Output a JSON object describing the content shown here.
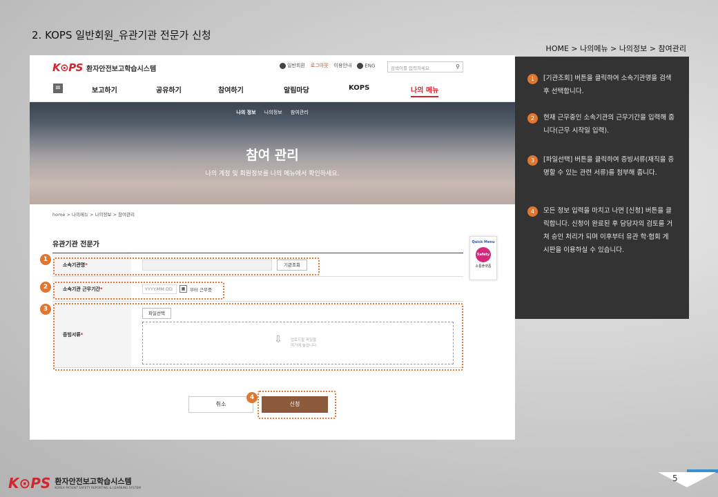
{
  "slide": {
    "heading": "2. KOPS 일반회원_유관기관 전문가 신청",
    "breadcrumb": "HOME > 나의메뉴 > 나의정보 > 참여관리",
    "page_number": "5"
  },
  "site": {
    "logo_mark": "K⊙PS",
    "logo_text": "환자안전보고학습시스템",
    "util_links": [
      "일반회원",
      "로그아웃",
      "이용안내",
      "ENG"
    ],
    "search_placeholder": "검색어를 입력하세요",
    "menu_items": [
      "보고하기",
      "공유하기",
      "참여하기",
      "알림마당",
      "KOPS",
      "나의 메뉴"
    ],
    "active_menu": "나의 메뉴"
  },
  "hero": {
    "tabs": [
      "나의 정보",
      "나의정보",
      "참여관리"
    ],
    "title": "참여 관리",
    "subtitle": "나의 계정 및 회원정보를 나의 메뉴에서 확인하세요."
  },
  "breadcrumb": "home > 나의메뉴 > 나의정보 > 참여관리",
  "form": {
    "section_title": "유관기관 전문가",
    "org_label": "소속기관명",
    "org_search_button": "기관조회",
    "period_label": "소속기관 근무기간",
    "date_placeholder": "YYYY.MM.DD",
    "period_suffix": "부터 근무중",
    "docs_label": "증빙서류",
    "file_button": "파일선택",
    "dropzone_text_1": "업로드할 파일을",
    "dropzone_text_2": "여기에 놓습니다.",
    "cancel_button": "취소",
    "submit_button": "신청"
  },
  "quick_menu": {
    "title": "Quick Menu",
    "badge": "Safety",
    "label": "소통플랫폼"
  },
  "markers": [
    "1",
    "2",
    "3",
    "4"
  ],
  "steps": [
    {
      "num": "1",
      "text": "[기관조회] 버튼을 클릭하여 소속기관명을 검색 후 선택합니다."
    },
    {
      "num": "2",
      "text": "현재 근무중인 소속기관의 근무기간을 입력해 줍니다(근무 시작일 입력)."
    },
    {
      "num": "3",
      "text": "[파일선택] 버튼을 클릭하여 증빙서류(재직을 증명할 수 있는 관련 서류)를 첨부해 줍니다."
    },
    {
      "num": "4",
      "text": "모든 정보 입력을 마치고 나면 [신청] 버튼을 클릭합니다. 신청이 완료된 후 담당자의 검토를 거쳐 승인 처리가 되며 이후부터 유관 학·협회 게시판을 이용하실 수 있습니다."
    }
  ],
  "footer": {
    "logo_mark": "K⊙PS",
    "name": "환자안전보고학습시스템",
    "sub": "KOREA PATIENT SAFETY REPORTING & LEARNING SYSTEM"
  },
  "colors": {
    "accent": "#e07630",
    "brand_red": "#d0262e",
    "submit": "#8a5a3b",
    "panel": "#333333"
  }
}
